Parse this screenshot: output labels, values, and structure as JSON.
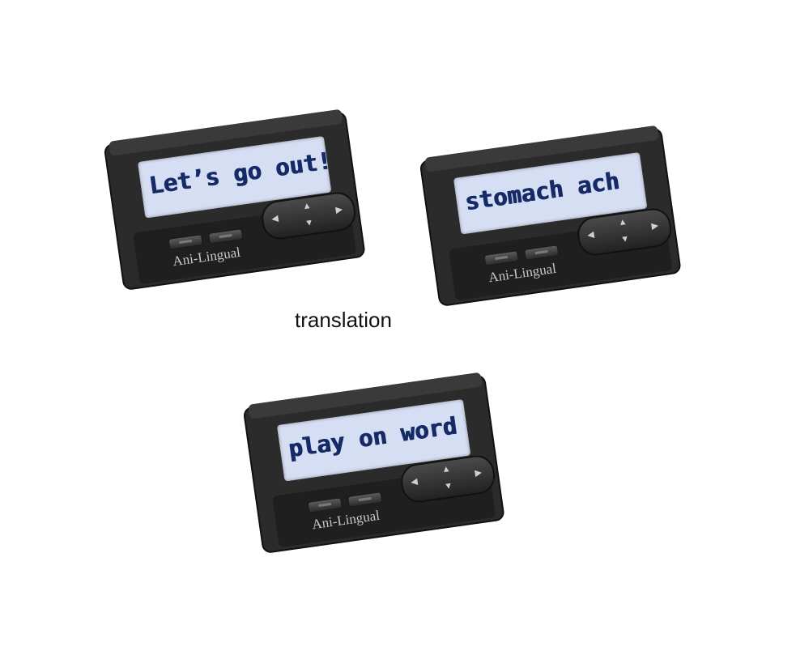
{
  "devices": [
    {
      "screen_text": "Let’s go out!",
      "brand": "Ani-Lingual"
    },
    {
      "screen_text": "stomach ach",
      "brand": "Ani-Lingual"
    },
    {
      "screen_text": "play on word",
      "brand": "Ani-Lingual"
    }
  ],
  "center_label": "translation",
  "colors": {
    "device_body": "#2a2a2a",
    "screen_bg": "#d5def2",
    "screen_text": "#152a66",
    "background": "#ffffff"
  },
  "icons": {
    "nav_up": "triangle-up-icon",
    "nav_down": "triangle-down-icon",
    "nav_left": "triangle-left-icon",
    "nav_right": "triangle-right-icon"
  }
}
